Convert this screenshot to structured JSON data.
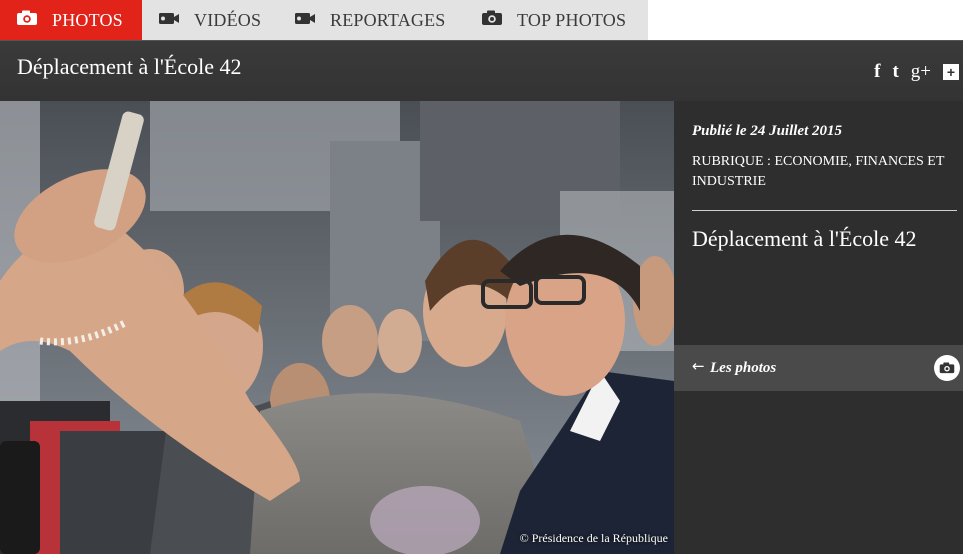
{
  "nav": {
    "tabs": [
      {
        "label": "PHOTOS",
        "icon": "camera-icon",
        "active": true
      },
      {
        "label": "VIDÉOS",
        "icon": "video-camera-icon",
        "active": false
      },
      {
        "label": "REPORTAGES",
        "icon": "video-camera-icon",
        "active": false
      },
      {
        "label": "TOP PHOTOS",
        "icon": "camera-icon",
        "active": false
      }
    ]
  },
  "header": {
    "title": "Déplacement à l'École 42",
    "social": {
      "facebook": "f",
      "twitter": "t",
      "googleplus": "g+",
      "more": "+"
    }
  },
  "photo": {
    "credit": "©  Présidence de la République"
  },
  "sidebar": {
    "published": "Publié le 24 Juillet 2015",
    "rubrique": "RUBRIQUE : ECONOMIE, FINANCES ET INDUSTRIE",
    "title": "Déplacement à l'École 42",
    "photos_link": {
      "arrow": "←",
      "label": "Les photos"
    }
  },
  "colors": {
    "accent": "#e2231a",
    "dark": "#2e2e2e",
    "bar": "#4a4a4a"
  }
}
